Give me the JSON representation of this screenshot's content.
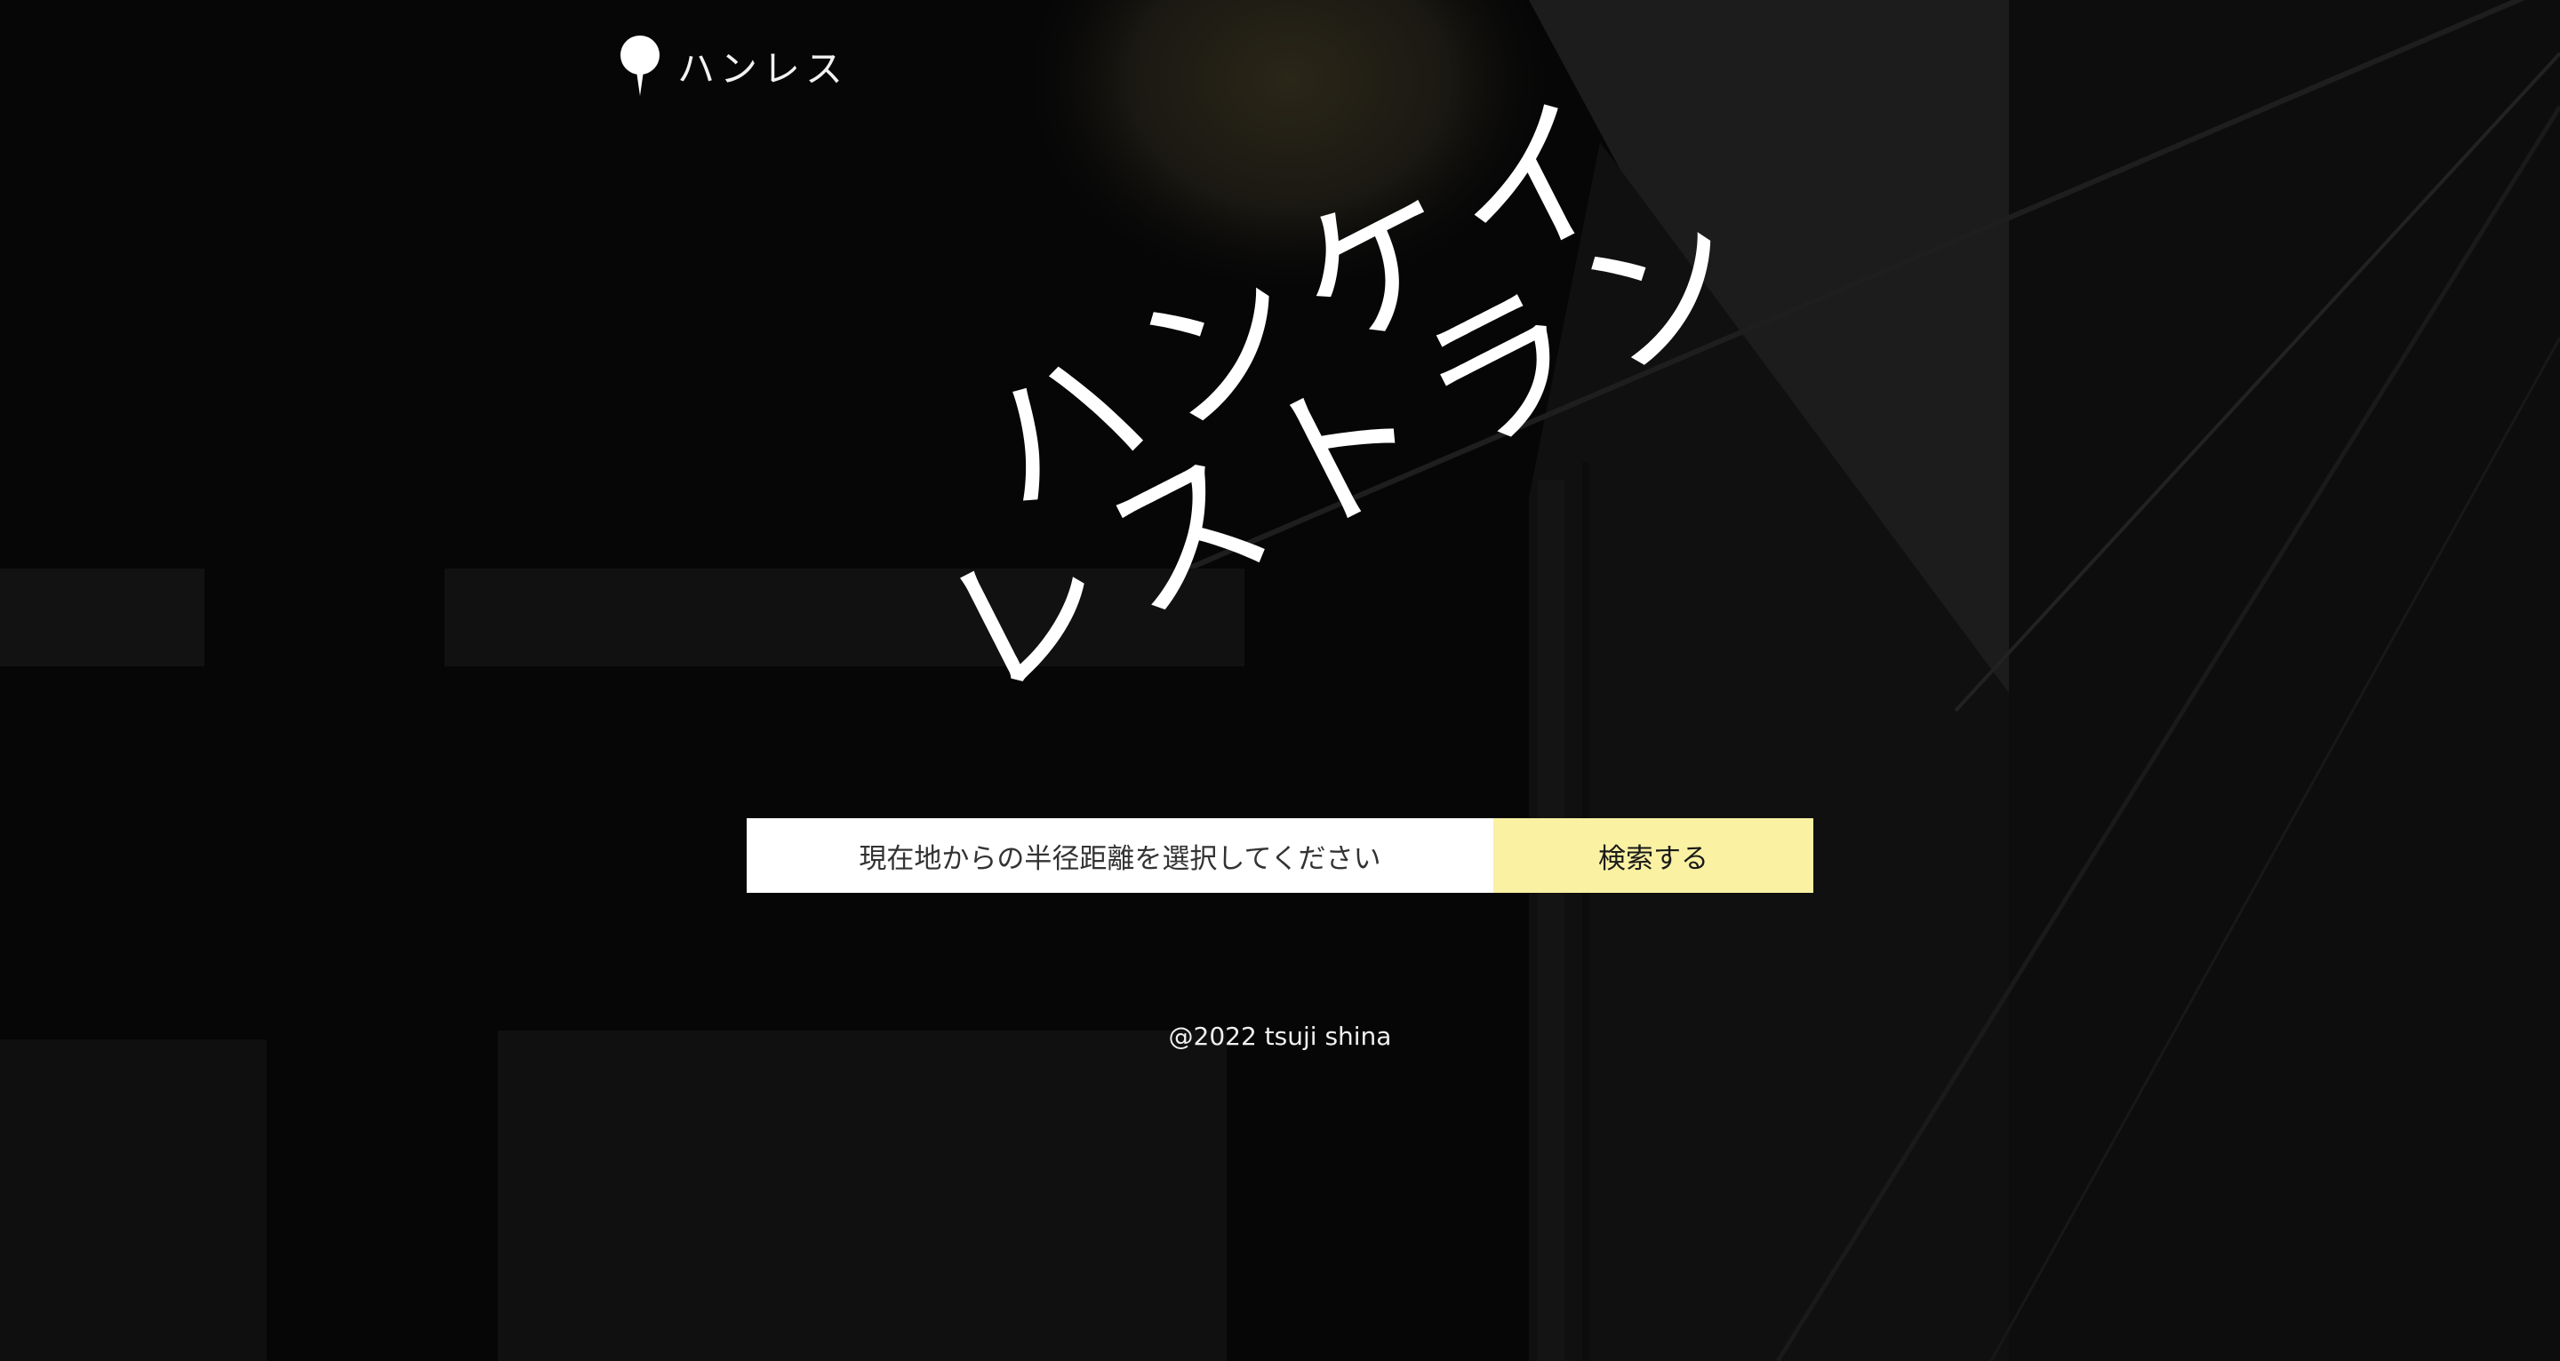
{
  "header": {
    "logo_icon": "map-pin-icon",
    "logo_text": "ハンレス"
  },
  "hero": {
    "line1": "ハンケイ",
    "line2": "レストラン"
  },
  "search": {
    "radius_select_value": "現在地からの半径距離を選択してください",
    "button_label": "検索する"
  },
  "footer": {
    "copyright": "@2022 tsuji shina"
  },
  "colors": {
    "background": "#060606",
    "button_bg": "#fbf1a3",
    "select_bg": "#ffffff",
    "text": "#ffffff"
  }
}
